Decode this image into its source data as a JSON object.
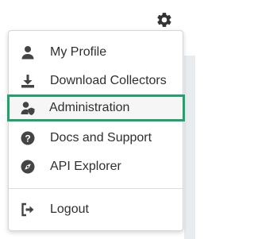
{
  "header": {
    "settings_icon": "gear-icon"
  },
  "menu": {
    "items": [
      {
        "label": "My Profile",
        "icon": "user-icon"
      },
      {
        "label": "Download Collectors",
        "icon": "download-icon"
      },
      {
        "label": "Administration",
        "icon": "user-shield-icon",
        "selected": true
      },
      {
        "label": "Docs and Support",
        "icon": "question-circle-icon"
      },
      {
        "label": "API Explorer",
        "icon": "compass-icon"
      }
    ],
    "logout": {
      "label": "Logout",
      "icon": "logout-icon"
    }
  },
  "colors": {
    "selected_border": "#1fa36a",
    "icon": "#444444",
    "text": "#2f2f2f"
  }
}
